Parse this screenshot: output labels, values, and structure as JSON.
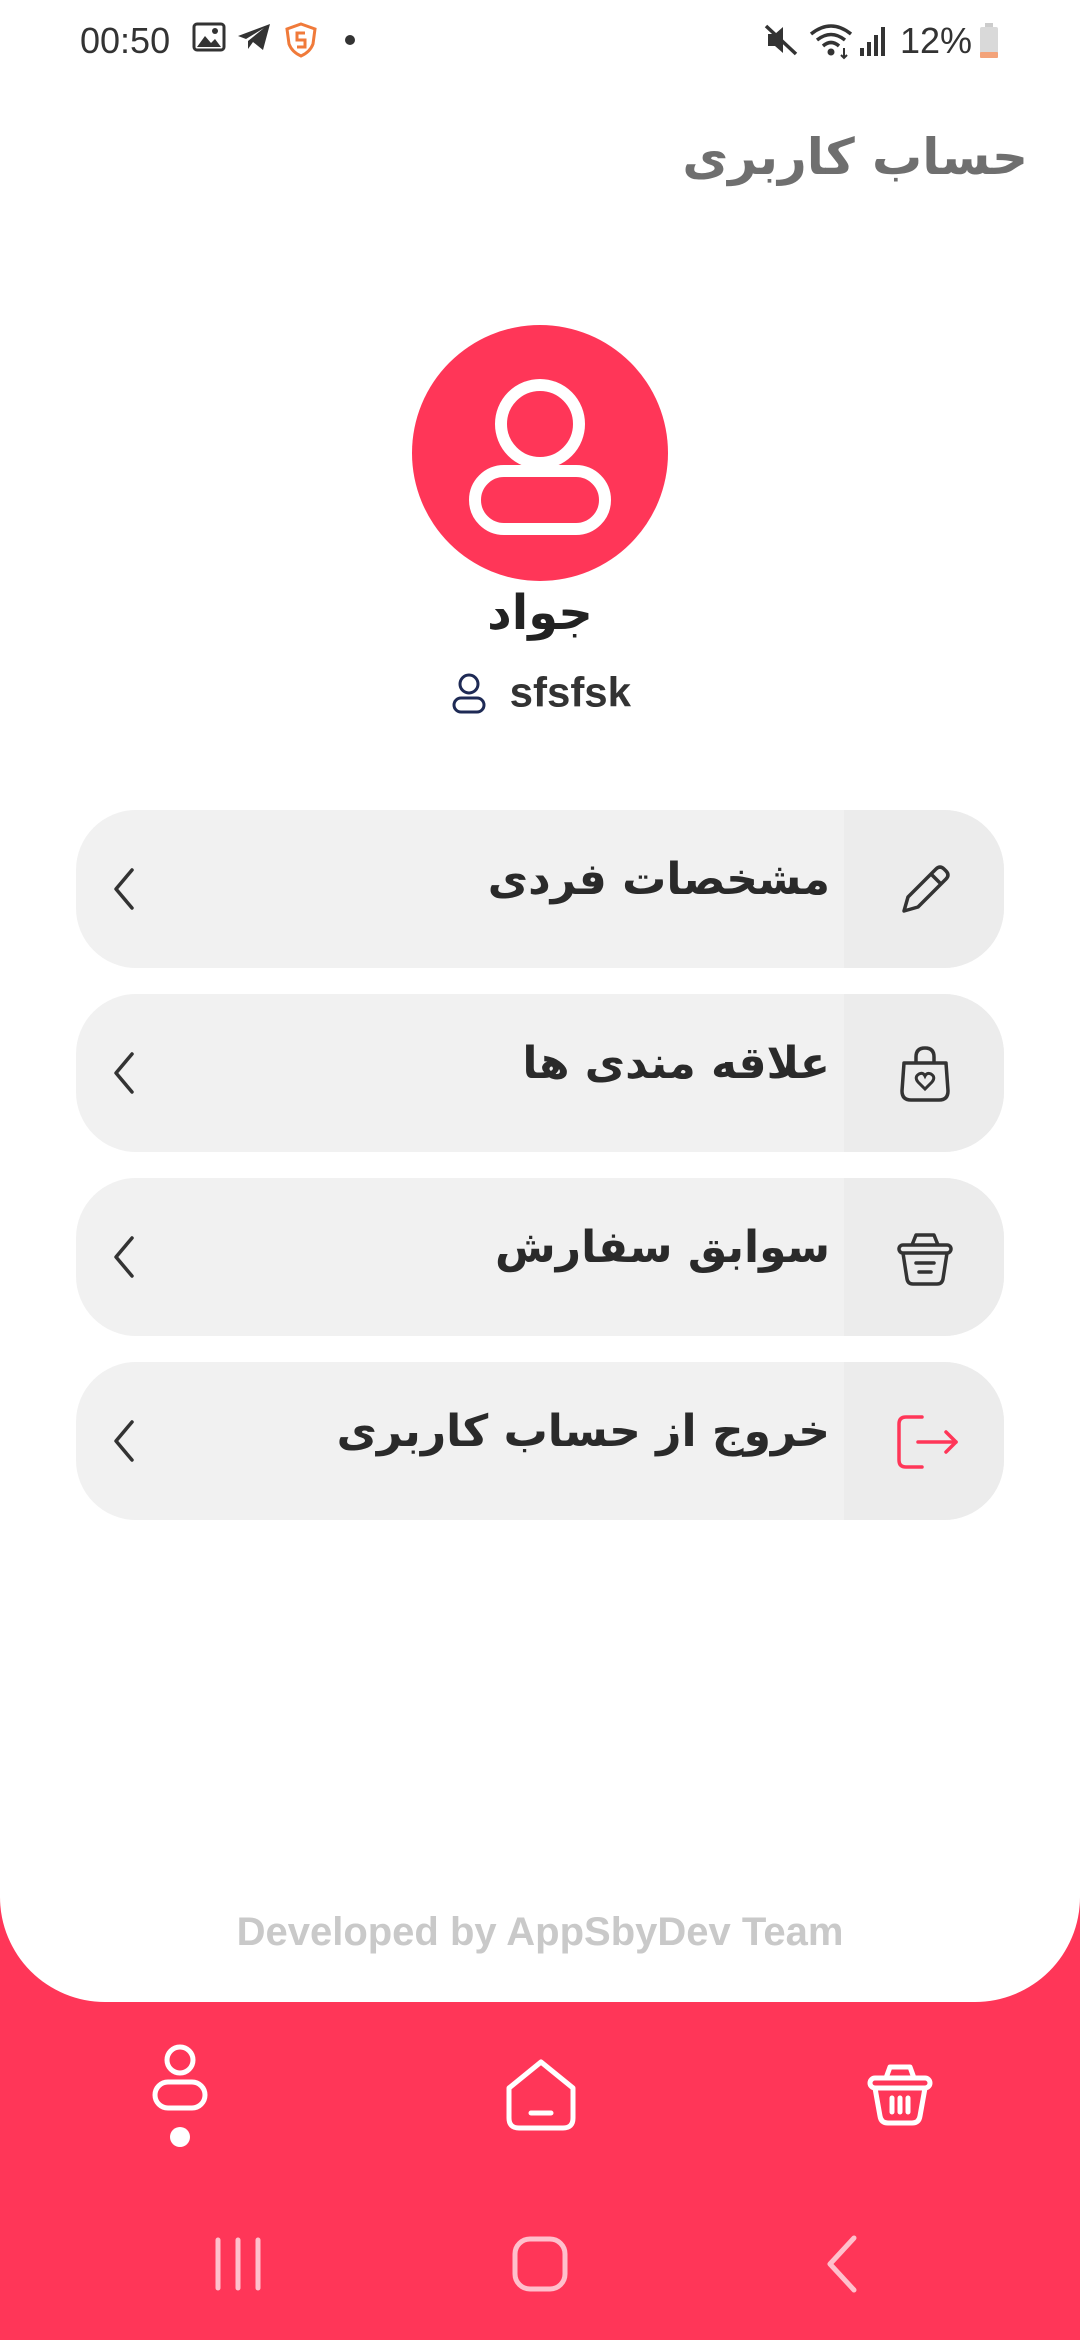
{
  "status_bar": {
    "time": "00:50",
    "battery": "12%"
  },
  "header": {
    "title": "حساب کاربری"
  },
  "profile": {
    "name": "جواد",
    "username": "sfsfsk"
  },
  "menu": [
    {
      "label": "مشخصات فردی",
      "icon": "pencil-icon"
    },
    {
      "label": "علاقه مندی ها",
      "icon": "heart-bag-icon"
    },
    {
      "label": "سوابق سفارش",
      "icon": "basket-icon"
    },
    {
      "label": "خروج از حساب کاربری",
      "icon": "logout-icon"
    }
  ],
  "footer": {
    "credit": "Developed by AppSbyDev Team"
  },
  "bottom_nav": {
    "items": [
      "profile-icon",
      "home-icon",
      "basket-icon"
    ],
    "active": "profile-icon"
  },
  "colors": {
    "accent": "#ff3658",
    "card": "#f1f1f1",
    "title_gray": "#6f6f6f"
  }
}
